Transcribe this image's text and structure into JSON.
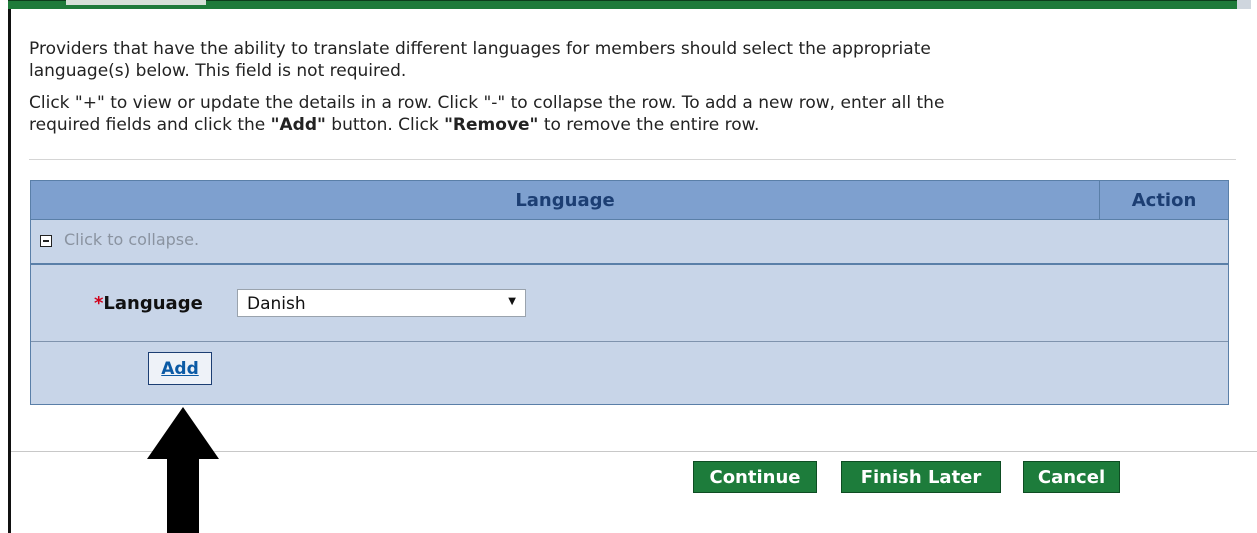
{
  "instructions": {
    "paragraph1_line1": "Providers that have the ability to translate different languages for members should select the appropriate",
    "paragraph1_line2": "language(s) below. This field is not required.",
    "paragraph2_line1": "Click \"+\" to view or update the details in a row. Click \"-\" to collapse the row. To add a new row, enter all the",
    "paragraph2_line2_a": "required fields and click the ",
    "paragraph2_line2_add": "\"Add\"",
    "paragraph2_line2_b": " button. Click ",
    "paragraph2_line2_remove": "\"Remove\"",
    "paragraph2_line2_c": " to remove the entire row."
  },
  "table": {
    "columns": [
      "Language",
      "Action"
    ],
    "collapse_text": "Click to collapse.",
    "field": {
      "required_mark": "*",
      "label": "Language",
      "selected_value": "Danish",
      "dropdown_arrow": "▼"
    },
    "add_button_label": "Add"
  },
  "footer": {
    "continue_label": "Continue",
    "finish_later_label": "Finish Later",
    "cancel_label": "Cancel"
  },
  "annotation": {
    "icon": "up-arrow-icon",
    "color": "#000000"
  },
  "colors": {
    "header_bg": "#7ea0cf",
    "panel_bg": "#c8d5e8",
    "header_text": "#1c3e73",
    "button_green": "#1d7c3b",
    "required_red": "#d0021b",
    "link_blue": "#0b5aa5"
  }
}
